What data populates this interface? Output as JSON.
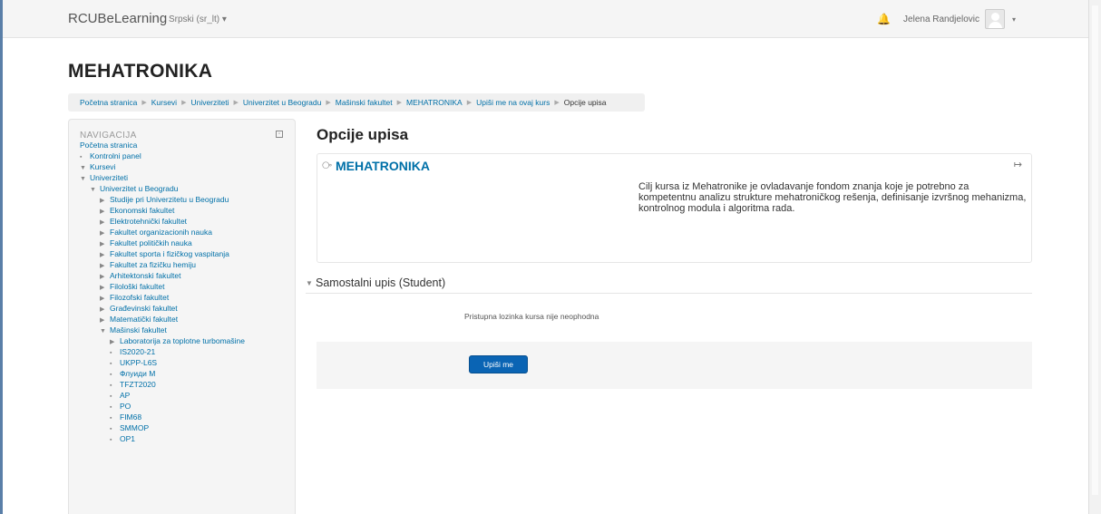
{
  "navbar": {
    "brand": "RCUBeLearning",
    "language": "Srpski (sr_lt) ▾",
    "user_name": "Jelena Randjelovic",
    "user_caret": "▾"
  },
  "page_title": "MEHATRONIKA",
  "breadcrumb": [
    "Početna stranica",
    "Kursevi",
    "Univerziteti",
    "Univerzitet u Beogradu",
    "Mašinski fakultet",
    "MEHATRONIKA",
    "Upiši me na ovaj kurs",
    "Opcije upisa"
  ],
  "breadcrumb_separator": "▶",
  "navigation": {
    "header": "NAVIGACIJA",
    "home": "Početna stranica",
    "items": [
      {
        "label": "Kontrolni panel",
        "indent": 0,
        "marker": "bullet"
      },
      {
        "label": "Kursevi",
        "indent": 0,
        "marker": "down"
      },
      {
        "label": "Univerziteti",
        "indent": 1,
        "marker": "down"
      },
      {
        "label": "Univerzitet u Beogradu",
        "indent": 2,
        "marker": "down"
      },
      {
        "label": "Studije pri Univerzitetu u Beogradu",
        "indent": 3,
        "marker": "right"
      },
      {
        "label": "Ekonomski fakultet",
        "indent": 3,
        "marker": "right"
      },
      {
        "label": "Elektrotehnički fakultet",
        "indent": 3,
        "marker": "right"
      },
      {
        "label": "Fakultet organizacionih nauka",
        "indent": 3,
        "marker": "right"
      },
      {
        "label": "Fakultet političkih nauka",
        "indent": 3,
        "marker": "right"
      },
      {
        "label": "Fakultet sporta i fizičkog vaspitanja",
        "indent": 3,
        "marker": "right"
      },
      {
        "label": "Fakultet za fizičku hemiju",
        "indent": 3,
        "marker": "right"
      },
      {
        "label": "Arhitektonski fakultet",
        "indent": 3,
        "marker": "right"
      },
      {
        "label": "Filološki fakultet",
        "indent": 3,
        "marker": "right"
      },
      {
        "label": "Filozofski fakultet",
        "indent": 3,
        "marker": "right"
      },
      {
        "label": "Građevinski fakultet",
        "indent": 3,
        "marker": "right"
      },
      {
        "label": "Matematički fakultet",
        "indent": 3,
        "marker": "right"
      },
      {
        "label": "Mašinski fakultet",
        "indent": 3,
        "marker": "down"
      },
      {
        "label": "Laboratorija za toplotne turbomašine",
        "indent": 4,
        "marker": "right"
      },
      {
        "label": "IS2020-21",
        "indent": 4,
        "marker": "bullet"
      },
      {
        "label": "UKPP-L6S",
        "indent": 4,
        "marker": "bullet"
      },
      {
        "label": "Флуиди М",
        "indent": 4,
        "marker": "bullet"
      },
      {
        "label": "TFZT2020",
        "indent": 4,
        "marker": "bullet"
      },
      {
        "label": "AP",
        "indent": 4,
        "marker": "bullet"
      },
      {
        "label": "PO",
        "indent": 4,
        "marker": "bullet"
      },
      {
        "label": "FIM68",
        "indent": 4,
        "marker": "bullet"
      },
      {
        "label": "SMMOP",
        "indent": 4,
        "marker": "bullet"
      },
      {
        "label": "OP1",
        "indent": 4,
        "marker": "bullet"
      }
    ]
  },
  "main": {
    "heading": "Opcije upisa",
    "course_name": "MEHATRONIKA",
    "course_summary": "Cilj kursa iz Mehatronike je ovladavanje fondom znanja koje je potrebno za kompetentnu analizu strukture mehatroničkog rešenja, definisanje izvršnog mehanizma, kontrolnog modula i algoritma rada.",
    "section_title": "Samostalni upis (Student)",
    "no_key_text": "Pristupna lozinka kursa nije neophodna",
    "enrol_button": "Upiši me"
  },
  "icons": {
    "notification": "bell-icon",
    "course": "course-icon",
    "self_enrol": "enrol-icon",
    "dock": "dock-icon"
  },
  "colors": {
    "link": "#0070a8",
    "button": "#0a64b4",
    "frame": "#5a7fa8"
  }
}
